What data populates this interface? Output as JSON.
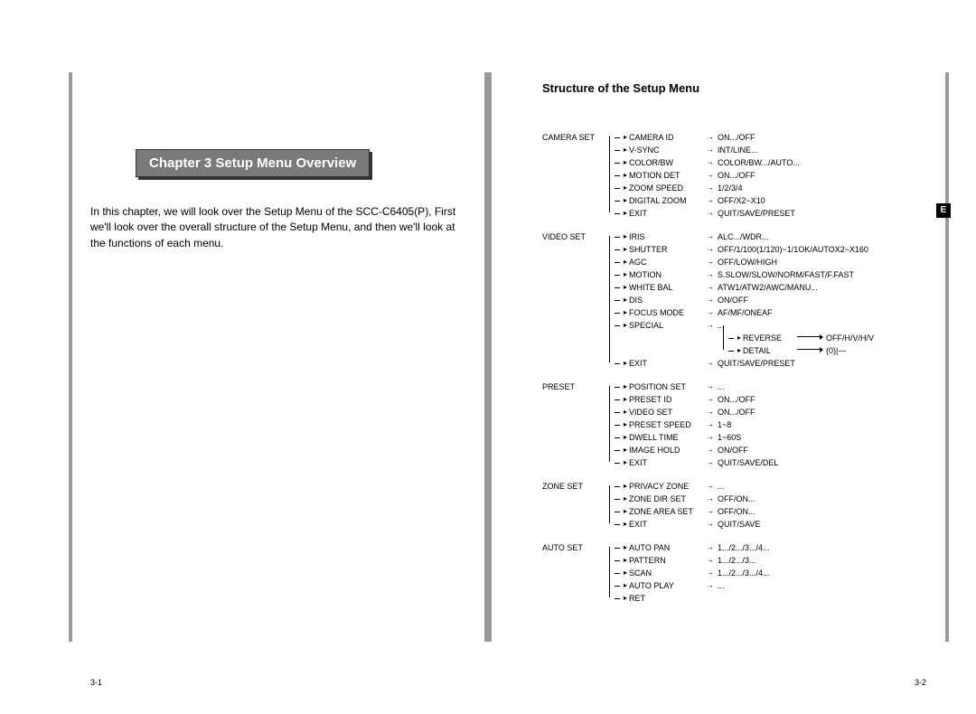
{
  "left": {
    "chapter_title": "Chapter 3  Setup Menu Overview",
    "intro": "In this chapter, we will look over the Setup Menu of the SCC-C6405(P), First we'll look over the overall structure of the Setup Menu, and then we'll look at the functions of each menu.",
    "page_num": "3-1"
  },
  "right": {
    "section_title": "Structure of the Setup Menu",
    "tab": "E",
    "page_num": "3-2",
    "trunks": [
      {
        "label": "CAMERA SET",
        "branches": [
          {
            "label": "CAMERA ID",
            "val": "ON.../OFF"
          },
          {
            "label": "V-SYNC",
            "val": "INT/LINE..."
          },
          {
            "label": "COLOR/BW",
            "val": "COLOR/BW.../AUTO..."
          },
          {
            "label": "MOTION DET",
            "val": "ON.../OFF"
          },
          {
            "label": "ZOOM SPEED",
            "val": "1/2/3/4"
          },
          {
            "label": "DIGITAL ZOOM",
            "val": "OFF/X2~X10"
          },
          {
            "label": "EXIT",
            "val": "QUIT/SAVE/PRESET"
          }
        ]
      },
      {
        "label": "VIDEO SET",
        "branches": [
          {
            "label": "IRIS",
            "val": "ALC.../WDR..."
          },
          {
            "label": "SHUTTER",
            "val": "OFF/1/100(1/120)~1/1OK/AUTOX2~X160"
          },
          {
            "label": "AGC",
            "val": "OFF/LOW/HIGH"
          },
          {
            "label": "MOTION",
            "val": "S.SLOW/SLOW/NORM/FAST/F.FAST"
          },
          {
            "label": "WHITE BAL",
            "val": "ATW1/ATW2/AWC/MANU..."
          },
          {
            "label": "DIS",
            "val": "ON/OFF"
          },
          {
            "label": "FOCUS MODE",
            "val": "AF/MF/ONEAF"
          },
          {
            "label": "SPECIAL",
            "val": "...",
            "subs": [
              {
                "label": "REVERSE",
                "val": "OFF/H/V/H/V"
              },
              {
                "label": "DETAIL",
                "val": "(0)|---"
              }
            ]
          },
          {
            "label": "EXIT",
            "val": "QUIT/SAVE/PRESET"
          }
        ]
      },
      {
        "label": "PRESET",
        "branches": [
          {
            "label": "POSITION SET",
            "val": "..."
          },
          {
            "label": "PRESET ID",
            "val": "ON.../OFF"
          },
          {
            "label": "VIDEO SET",
            "val": "ON.../OFF"
          },
          {
            "label": "PRESET SPEED",
            "val": "1~8"
          },
          {
            "label": "DWELL TIME",
            "val": "1~60S"
          },
          {
            "label": "IMAGE HOLD",
            "val": "ON/OFF"
          },
          {
            "label": "EXIT",
            "val": "QUIT/SAVE/DEL"
          }
        ]
      },
      {
        "label": "ZONE SET",
        "branches": [
          {
            "label": "PRIVACY ZONE",
            "val": "..."
          },
          {
            "label": "ZONE DIR SET",
            "val": "OFF/ON..."
          },
          {
            "label": "ZONE AREA SET",
            "val": "OFF/ON..."
          },
          {
            "label": "EXIT",
            "val": "QUIT/SAVE"
          }
        ]
      },
      {
        "label": "AUTO SET",
        "branches": [
          {
            "label": "AUTO PAN",
            "val": "1.../2.../3.../4..."
          },
          {
            "label": "PATTERN",
            "val": "1.../2.../3..."
          },
          {
            "label": "SCAN",
            "val": "1.../2.../3.../4..."
          },
          {
            "label": "AUTO PLAY",
            "val": "..."
          },
          {
            "label": "RET",
            "val": ""
          }
        ]
      }
    ]
  }
}
